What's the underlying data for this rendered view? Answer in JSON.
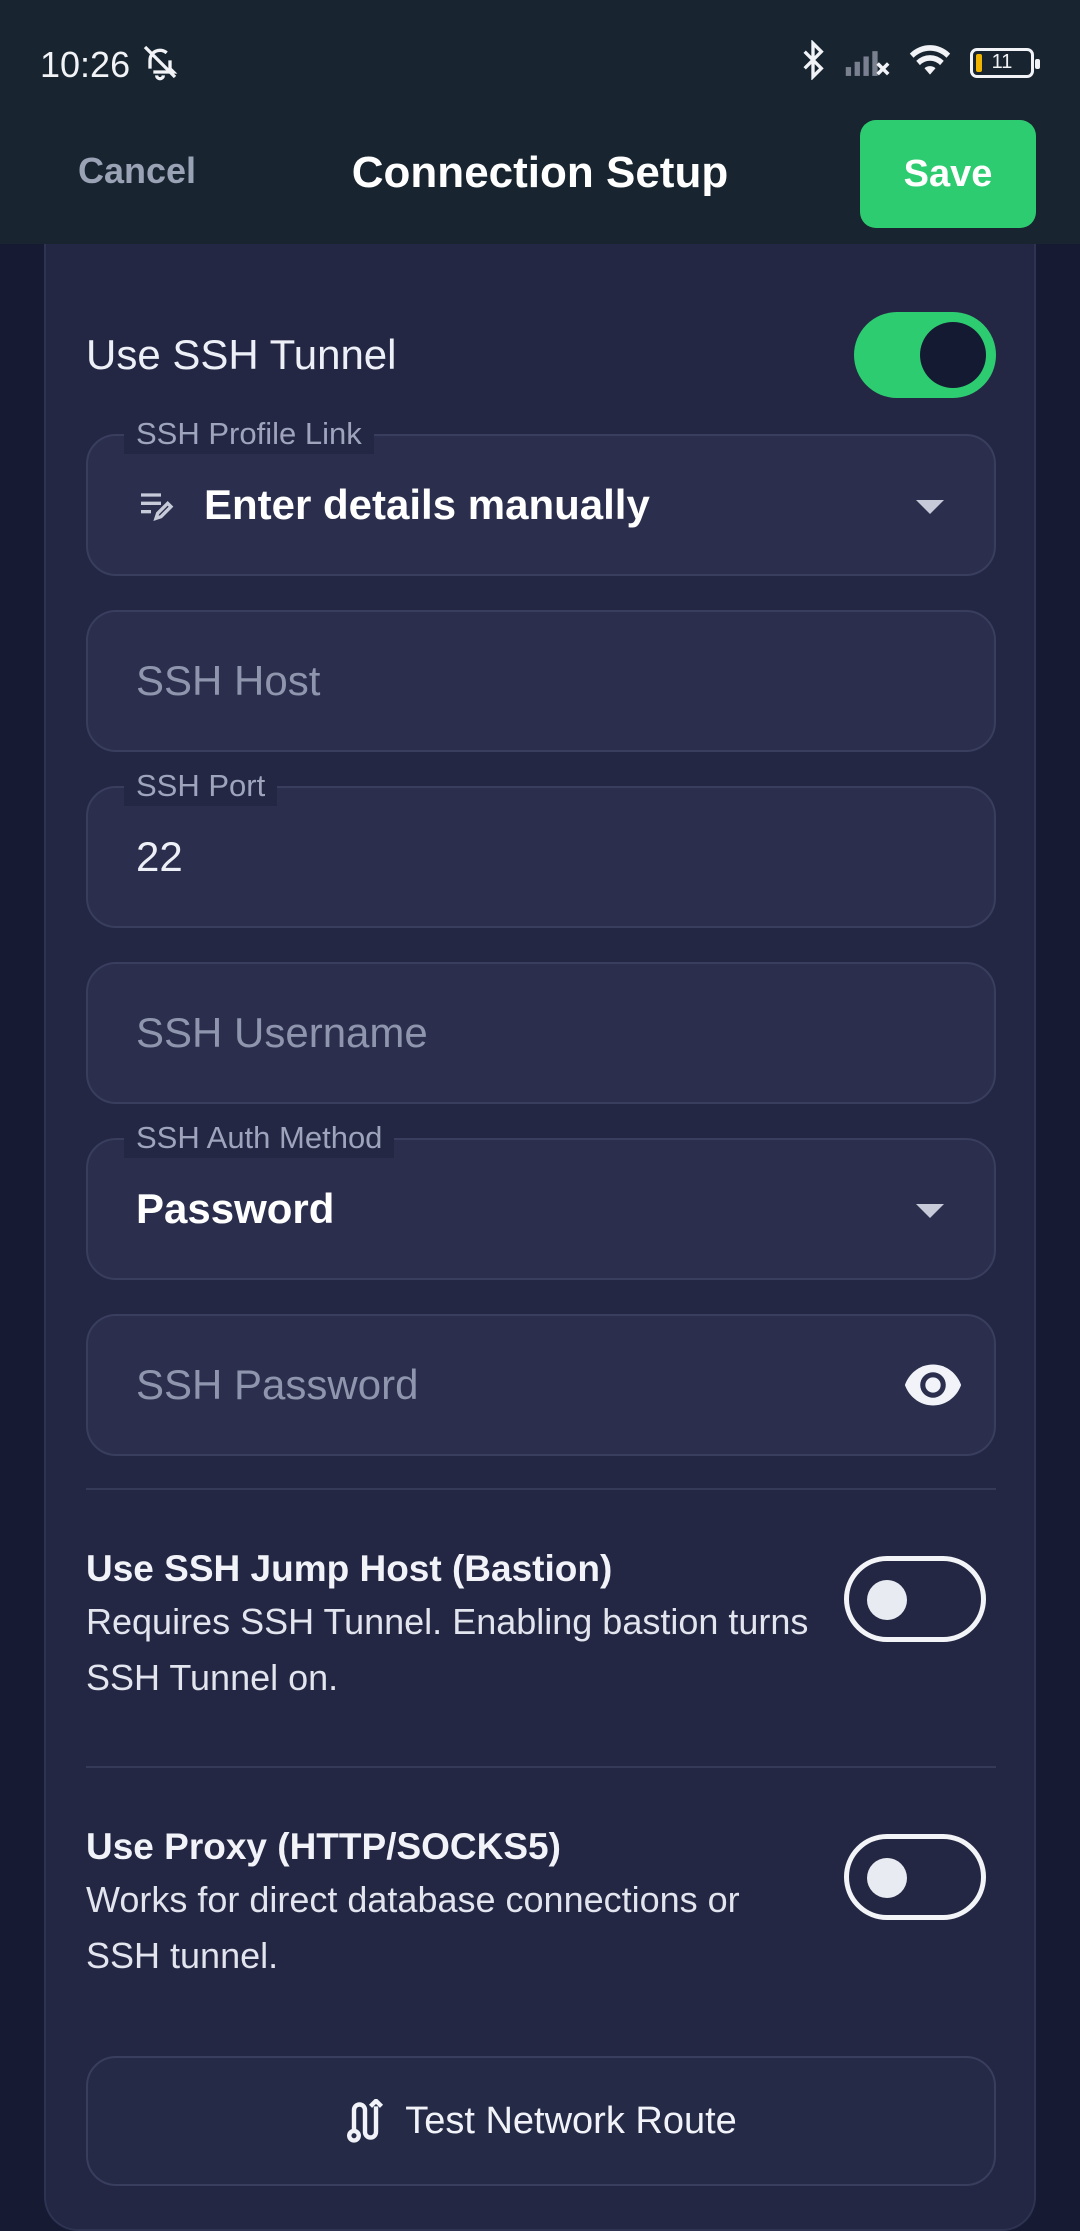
{
  "status_bar": {
    "time": "10:26",
    "battery": "11"
  },
  "app_bar": {
    "cancel": "Cancel",
    "title": "Connection Setup",
    "save": "Save"
  },
  "ssh": {
    "use_tunnel_label": "Use SSH Tunnel",
    "use_tunnel_on": true,
    "profile_link": {
      "label": "SSH Profile Link",
      "value": "Enter details manually"
    },
    "host": {
      "placeholder": "SSH Host"
    },
    "port": {
      "label": "SSH Port",
      "value": "22"
    },
    "username": {
      "placeholder": "SSH Username"
    },
    "auth_method": {
      "label": "SSH Auth Method",
      "value": "Password"
    },
    "password": {
      "placeholder": "SSH Password"
    }
  },
  "jump_host": {
    "title": "Use SSH Jump Host (Bastion)",
    "description": "Requires SSH Tunnel. Enabling bastion turns SSH Tunnel on.",
    "enabled": false
  },
  "proxy": {
    "title": "Use Proxy (HTTP/SOCKS5)",
    "description": "Works for direct database connections or SSH tunnel.",
    "enabled": false
  },
  "test_button": {
    "label": "Test Network Route"
  },
  "colors": {
    "accent": "#2ecc71",
    "background": "#161a33",
    "card": "#232744",
    "app_bar": "#18242f"
  }
}
